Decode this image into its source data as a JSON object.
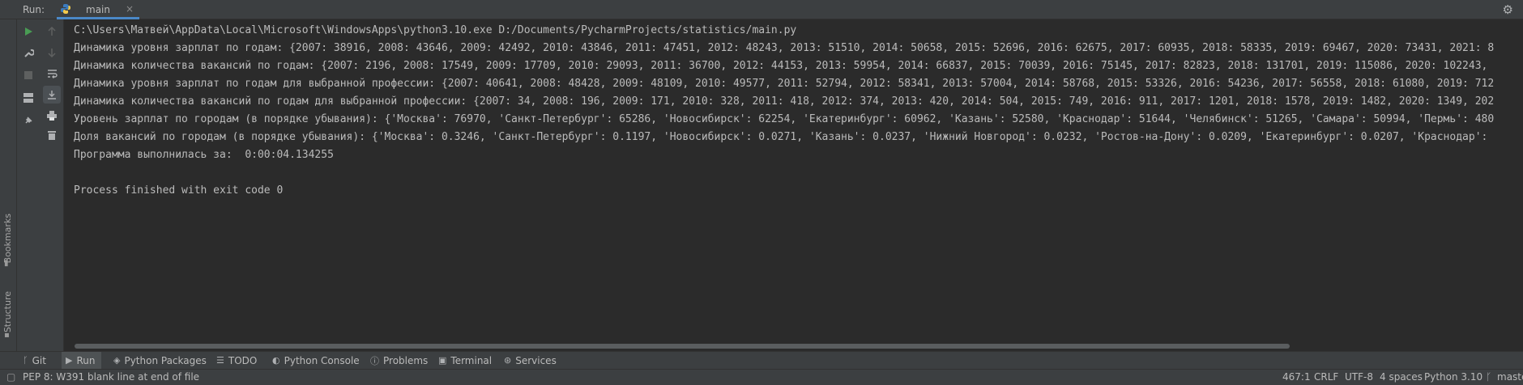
{
  "run_header": {
    "label": "Run:",
    "tab_title": "main",
    "close": "×"
  },
  "left_stripe": {
    "bookmarks": "Bookmarks",
    "structure": "Structure"
  },
  "console": {
    "lines": [
      "C:\\Users\\Матвей\\AppData\\Local\\Microsoft\\WindowsApps\\python3.10.exe D:/Documents/PycharmProjects/statistics/main.py",
      "Динамика уровня зарплат по годам: {2007: 38916, 2008: 43646, 2009: 42492, 2010: 43846, 2011: 47451, 2012: 48243, 2013: 51510, 2014: 50658, 2015: 52696, 2016: 62675, 2017: 60935, 2018: 58335, 2019: 69467, 2020: 73431, 2021: 8",
      "Динамика количества вакансий по годам: {2007: 2196, 2008: 17549, 2009: 17709, 2010: 29093, 2011: 36700, 2012: 44153, 2013: 59954, 2014: 66837, 2015: 70039, 2016: 75145, 2017: 82823, 2018: 131701, 2019: 115086, 2020: 102243,",
      "Динамика уровня зарплат по годам для выбранной профессии: {2007: 40641, 2008: 48428, 2009: 48109, 2010: 49577, 2011: 52794, 2012: 58341, 2013: 57004, 2014: 58768, 2015: 53326, 2016: 54236, 2017: 56558, 2018: 61080, 2019: 712",
      "Динамика количества вакансий по годам для выбранной профессии: {2007: 34, 2008: 196, 2009: 171, 2010: 328, 2011: 418, 2012: 374, 2013: 420, 2014: 504, 2015: 749, 2016: 911, 2017: 1201, 2018: 1578, 2019: 1482, 2020: 1349, 202",
      "Уровень зарплат по городам (в порядке убывания): {'Москва': 76970, 'Санкт-Петербург': 65286, 'Новосибирск': 62254, 'Екатеринбург': 60962, 'Казань': 52580, 'Краснодар': 51644, 'Челябинск': 51265, 'Самара': 50994, 'Пермь': 480",
      "Доля вакансий по городам (в порядке убывания): {'Москва': 0.3246, 'Санкт-Петербург': 0.1197, 'Новосибирск': 0.0271, 'Казань': 0.0237, 'Нижний Новгород': 0.0232, 'Ростов-на-Дону': 0.0209, 'Екатеринбург': 0.0207, 'Краснодар':",
      "Программа выполнилась за:  0:00:04.134255",
      "",
      "Process finished with exit code 0"
    ]
  },
  "tool_tabs": [
    {
      "label": "Git",
      "icon": "git-branch-icon"
    },
    {
      "label": "Run",
      "icon": "run-icon"
    },
    {
      "label": "Python Packages",
      "icon": "packages-icon"
    },
    {
      "label": "TODO",
      "icon": "todo-icon"
    },
    {
      "label": "Python Console",
      "icon": "python-console-icon"
    },
    {
      "label": "Problems",
      "icon": "problems-icon"
    },
    {
      "label": "Terminal",
      "icon": "terminal-icon"
    },
    {
      "label": "Services",
      "icon": "services-icon"
    }
  ],
  "status_bar": {
    "message": "PEP 8: W391 blank line at end of file",
    "position": "467:1",
    "line_separator": "CRLF",
    "encoding": "UTF-8",
    "indent": "4 spaces",
    "interpreter": "Python 3.10",
    "vcs": "maste"
  },
  "colors": {
    "accent": "#4a88c7",
    "run_green": "#499c54",
    "background": "#2b2b2b",
    "panel": "#3c3f41"
  }
}
